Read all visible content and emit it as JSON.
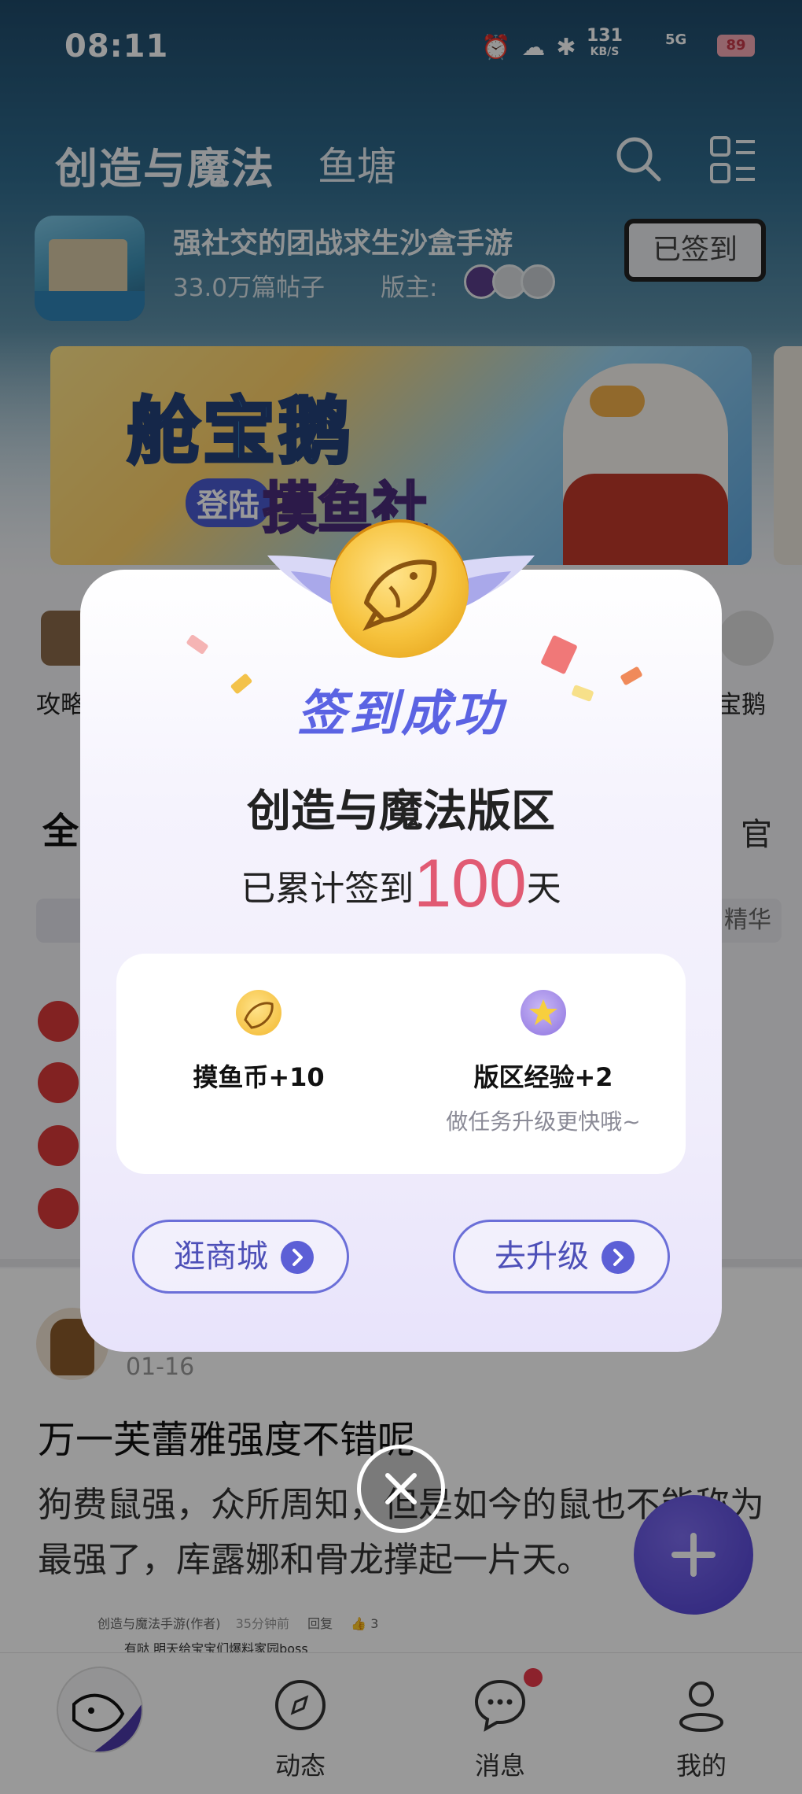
{
  "status_bar": {
    "time": "08:11",
    "net_speed_value": "131",
    "net_speed_unit": "KB/S",
    "network": "5G",
    "battery": "89"
  },
  "header": {
    "title": "创造与魔法",
    "second_tab": "鱼塘",
    "search_icon": "search-icon",
    "menu_icon": "grid-menu-icon"
  },
  "forum": {
    "description": "强社交的团战求生沙盒手游",
    "post_count": "33.0万篇帖子",
    "moderators_label": "版主:",
    "checkin_button": "已签到"
  },
  "banner": {
    "headline": "舱宝鹅",
    "sub_a": "登陆",
    "sub_b": "摸鱼社"
  },
  "shortcuts": {
    "left_label": "攻略",
    "right_label": "宝鹅"
  },
  "feed_tabs": {
    "left": "全",
    "right": "官"
  },
  "filter_chips": {
    "right": "精华"
  },
  "post": {
    "date": "01-16",
    "title": "万一芙蕾雅强度不错呢",
    "body": "狗费鼠强，众所周知，但是如今的鼠也不能称为最强了，库露娜和骨龙撑起一片天。",
    "reply_author": "创造与魔法手游(作者)",
    "reply_time": "35分钟前",
    "reply_action": "回复",
    "reply_likes": "3",
    "reply_text": "有哒 明天给宝宝们爆料家园boss"
  },
  "bottom_nav": {
    "items": [
      {
        "label": "",
        "icon": "home-fish-icon"
      },
      {
        "label": "动态",
        "icon": "compass-icon"
      },
      {
        "label": "消息",
        "icon": "chat-bubble-icon"
      },
      {
        "label": "我的",
        "icon": "profile-icon"
      }
    ]
  },
  "dialog": {
    "title": "签到成功",
    "forum_name": "创造与魔法版区",
    "streak_prefix": "已累计签到",
    "streak_days": "100",
    "streak_suffix": "天",
    "rewards": [
      {
        "label": "摸鱼币+10",
        "sub": "",
        "icon": "fish-coin-icon"
      },
      {
        "label": "版区经验+2",
        "sub": "做任务升级更快哦~",
        "icon": "star-badge-icon"
      }
    ],
    "buttons": [
      {
        "label": "逛商城"
      },
      {
        "label": "去升级"
      }
    ],
    "close_icon": "close-icon"
  },
  "colors": {
    "accent": "#5c5fd6",
    "streak_number": "#e15a73",
    "coin_gold": "#f6c23c",
    "fab": "#5a4be0"
  }
}
